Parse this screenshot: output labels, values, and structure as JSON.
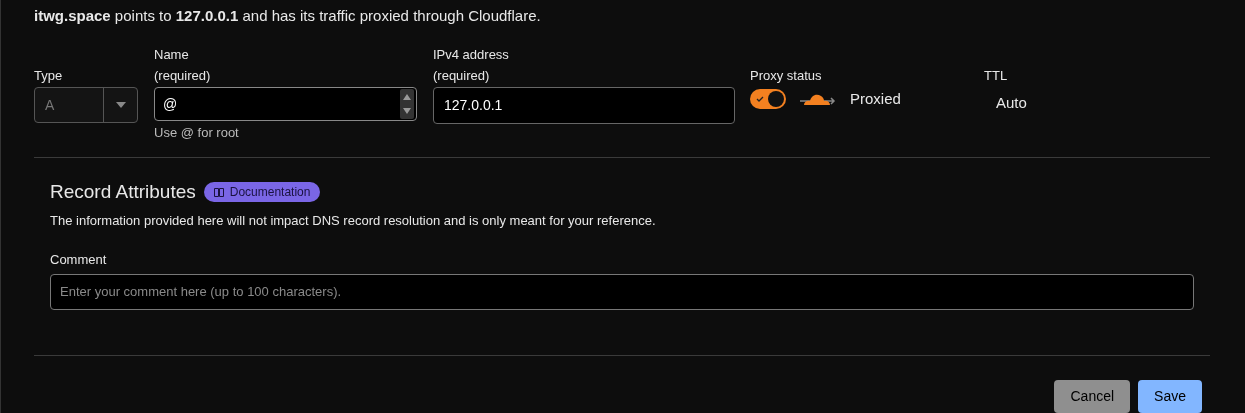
{
  "summary": "**itwg.space** points to **127.0.0.1** and has its traffic proxied through Cloudflare.",
  "fields": {
    "type": {
      "label": "Type",
      "value": "A",
      "disabled": true
    },
    "name": {
      "label": "Name",
      "required": "(required)",
      "value": "@",
      "hint": "Use @ for root"
    },
    "ipv4": {
      "label": "IPv4 address",
      "required": "(required)",
      "value": "127.0.0.1"
    },
    "proxy": {
      "label": "Proxy status",
      "on": true,
      "text": "Proxied"
    },
    "ttl": {
      "label": "TTL",
      "value": "Auto"
    }
  },
  "attributes": {
    "title": "Record Attributes",
    "badge": "Documentation",
    "description": "The information provided here will not impact DNS record resolution and is only meant for your reference.",
    "comment": {
      "label": "Comment",
      "placeholder": "Enter your comment here (up to 100 characters)."
    }
  },
  "buttons": [
    {
      "label": "Cancel",
      "kind": "secondary"
    },
    {
      "label": "Save",
      "kind": "primary"
    }
  ]
}
